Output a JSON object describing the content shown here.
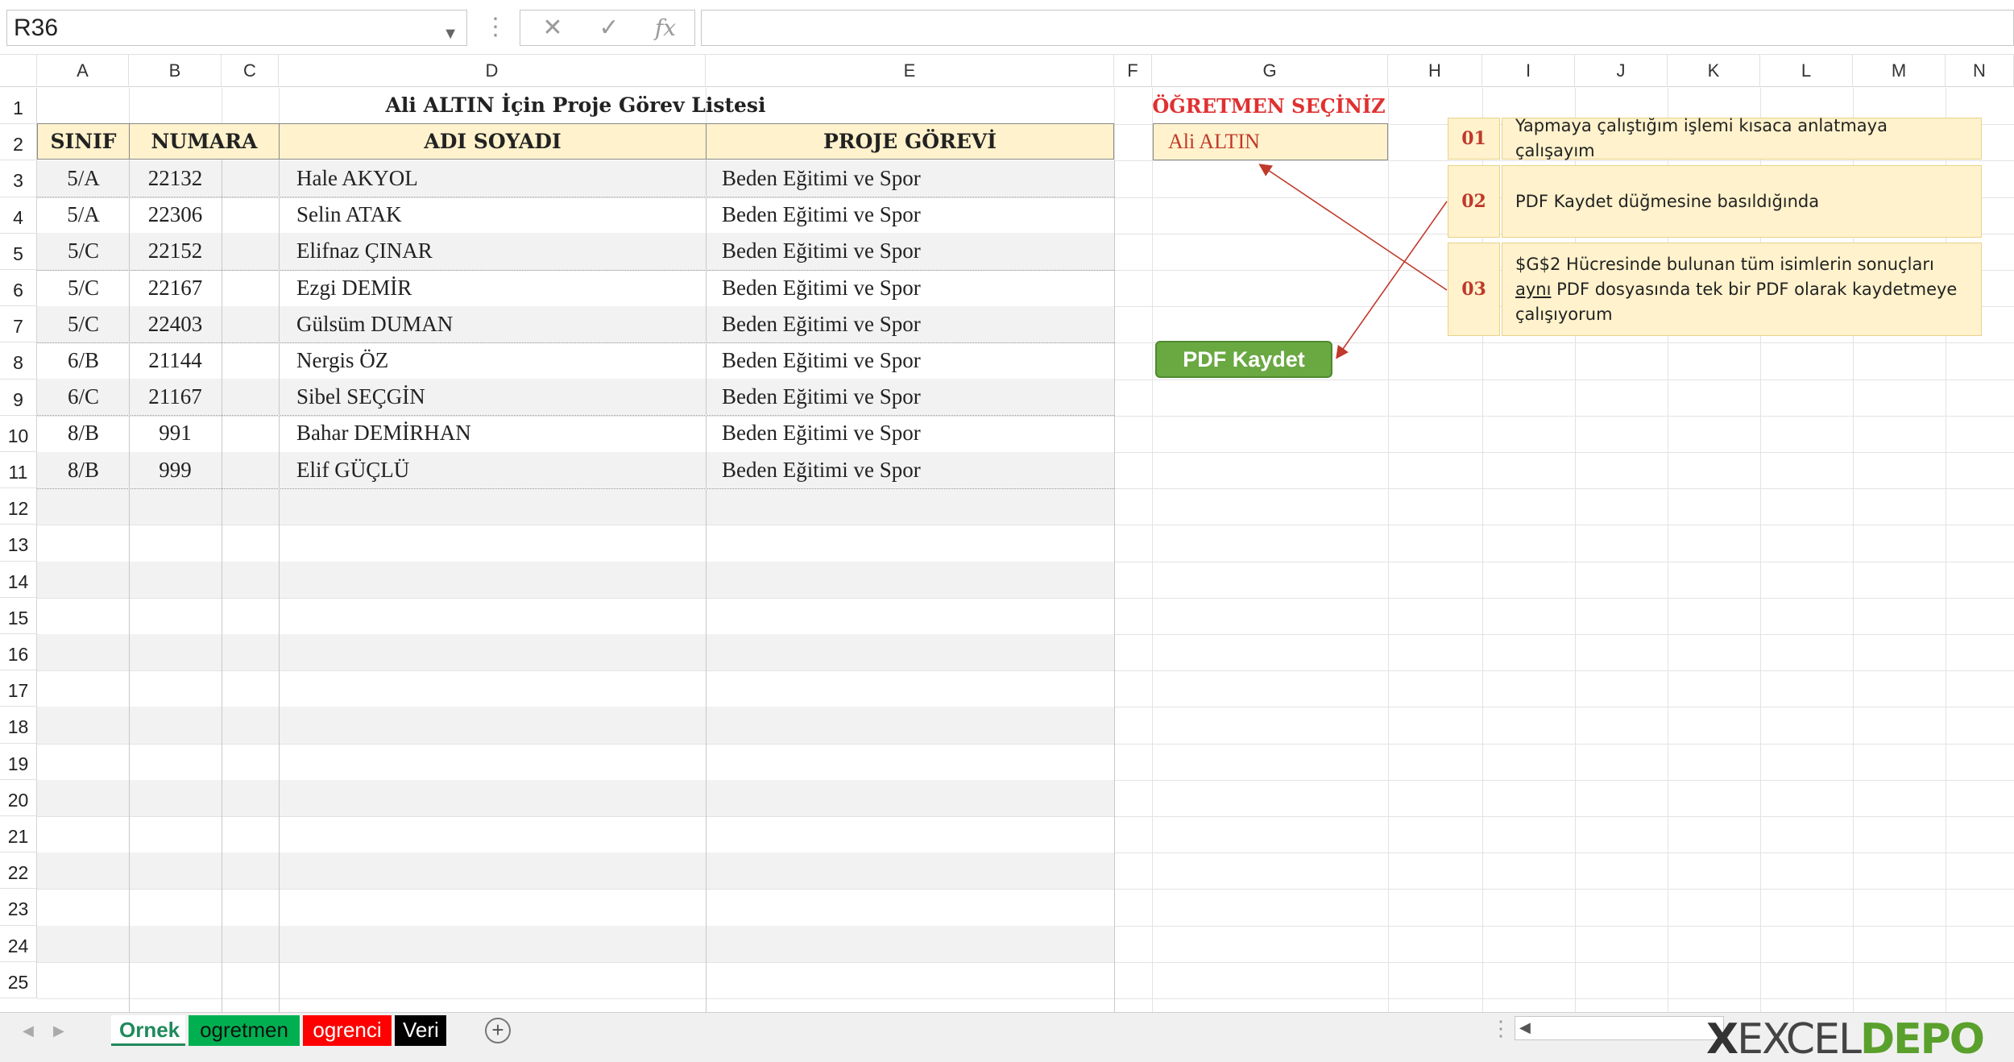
{
  "formula_bar": {
    "name_box": "R36",
    "cancel_glyph": "✕",
    "enter_glyph": "✓",
    "fx_label": "fx",
    "formula": ""
  },
  "columns": [
    "A",
    "B",
    "C",
    "D",
    "E",
    "F",
    "G",
    "H",
    "I",
    "J",
    "K",
    "L",
    "M",
    "N"
  ],
  "rows": [
    "1",
    "2",
    "3",
    "4",
    "5",
    "6",
    "7",
    "8",
    "9",
    "10",
    "11",
    "12",
    "13",
    "14",
    "15",
    "16",
    "17",
    "18",
    "19",
    "20",
    "21",
    "22",
    "23",
    "24",
    "25"
  ],
  "sheet": {
    "title": "Ali ALTIN İçin Proje Görev Listesi",
    "headers": {
      "sinif": "SINIF",
      "numara": "NUMARA",
      "adi_soyadi": "ADI SOYADI",
      "proje_gorevi": "PROJE GÖREVİ"
    },
    "records": [
      {
        "sinif": "5/A",
        "numara": "22132",
        "ad": "Hale AKYOL",
        "gorev": "Beden Eğitimi ve Spor"
      },
      {
        "sinif": "5/A",
        "numara": "22306",
        "ad": "Selin ATAK",
        "gorev": "Beden Eğitimi ve Spor"
      },
      {
        "sinif": "5/C",
        "numara": "22152",
        "ad": "Elifnaz ÇINAR",
        "gorev": "Beden Eğitimi ve Spor"
      },
      {
        "sinif": "5/C",
        "numara": "22167",
        "ad": "Ezgi DEMİR",
        "gorev": "Beden Eğitimi ve Spor"
      },
      {
        "sinif": "5/C",
        "numara": "22403",
        "ad": "Gülsüm DUMAN",
        "gorev": "Beden Eğitimi ve Spor"
      },
      {
        "sinif": "6/B",
        "numara": "21144",
        "ad": "Nergis ÖZ",
        "gorev": "Beden Eğitimi ve Spor"
      },
      {
        "sinif": "6/C",
        "numara": "21167",
        "ad": "Sibel SEÇGİN",
        "gorev": "Beden Eğitimi ve Spor"
      },
      {
        "sinif": "8/B",
        "numara": "991",
        "ad": "Bahar DEMİRHAN",
        "gorev": "Beden Eğitimi ve Spor"
      },
      {
        "sinif": "8/B",
        "numara": "999",
        "ad": "Elif GÜÇLÜ",
        "gorev": "Beden Eğitimi ve Spor"
      }
    ],
    "teacher_label": "ÖĞRETMEN SEÇİNİZ",
    "teacher_value": "Ali ALTIN",
    "pdf_button": "PDF Kaydet"
  },
  "notes": [
    {
      "num": "01",
      "text": "Yapmaya çalıştığım işlemi kısaca anlatmaya çalışayım"
    },
    {
      "num": "02",
      "text": "PDF Kaydet düğmesine basıldığında"
    },
    {
      "num": "03",
      "text_before": "$G$2 Hücresinde bulunan tüm isimlerin sonuçları ",
      "text_underlined": "aynı",
      "text_after": " PDF dosyasında tek bir PDF olarak kaydetmeye çalışıyorum"
    }
  ],
  "tabs": [
    {
      "label": "Ornek",
      "bg": "#ffffff",
      "fg": "#1f8a5b",
      "active": true
    },
    {
      "label": "ogretmen",
      "bg": "#00b050",
      "fg": "#111111",
      "active": false
    },
    {
      "label": "ogrenci",
      "bg": "#ff0000",
      "fg": "#ffffff",
      "active": false
    },
    {
      "label": "Veri",
      "bg": "#000000",
      "fg": "#ffffff",
      "active": false
    }
  ],
  "tab_nav": {
    "prev": "◀",
    "next": "▶",
    "add": "+"
  },
  "logo": {
    "part1": "EXCEL",
    "part2": "DEPO"
  },
  "colors": {
    "header_fill": "#fff2cc",
    "accent_red": "#e03030",
    "button_green": "#6aa842",
    "arrow": "#c0392b"
  }
}
